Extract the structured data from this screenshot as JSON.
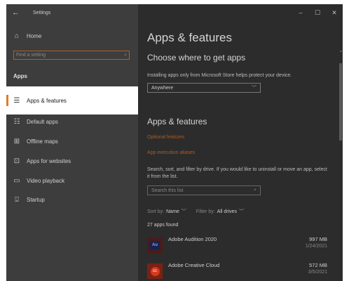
{
  "titlebar": {
    "back_icon": "back-arrow-icon",
    "title": "Settings",
    "minimize": "–",
    "maximize": "☐",
    "close": "✕"
  },
  "sidebar": {
    "home_label": "Home",
    "search_placeholder": "Find a setting",
    "section": "Apps",
    "items": [
      {
        "label": "Apps & features",
        "icon": "list-icon",
        "selected": true
      },
      {
        "label": "Default apps",
        "icon": "default-apps-icon"
      },
      {
        "label": "Offline maps",
        "icon": "map-icon"
      },
      {
        "label": "Apps for websites",
        "icon": "link-box-icon"
      },
      {
        "label": "Video playback",
        "icon": "video-icon"
      },
      {
        "label": "Startup",
        "icon": "startup-icon"
      }
    ]
  },
  "main": {
    "page_title": "Apps & features",
    "choose_heading": "Choose where to get apps",
    "choose_desc": "Installing apps only from Microsoft Store helps protect your device.",
    "source_dropdown_value": "Anywhere",
    "section_heading": "Apps & features",
    "link_optional": "Optional features",
    "link_aliases": "App execution aliases",
    "search_desc": "Search, sort, and filter by drive. If you would like to uninstall or move an app, select it from the list.",
    "search_placeholder": "Search this list",
    "sort_label": "Sort by:",
    "sort_value": "Name",
    "filter_label": "Filter by:",
    "filter_value": "All drives",
    "apps_count": "27 apps found",
    "apps": [
      {
        "name": "Adobe Audition 2020",
        "size": "997 MB",
        "date": "1/24/2021",
        "icon": "adobe-audition-icon",
        "badge": "Au"
      },
      {
        "name": "Adobe Creative Cloud",
        "size": "572 MB",
        "date": "3/5/2021",
        "icon": "adobe-creative-cloud-icon",
        "badge": "cc"
      }
    ]
  },
  "colors": {
    "accent": "#e07b24",
    "link": "#b05b1f",
    "sidebar_bg": "#3d3d3d",
    "content_bg": "#2c2c2c",
    "selected_bg": "#ffffff"
  }
}
